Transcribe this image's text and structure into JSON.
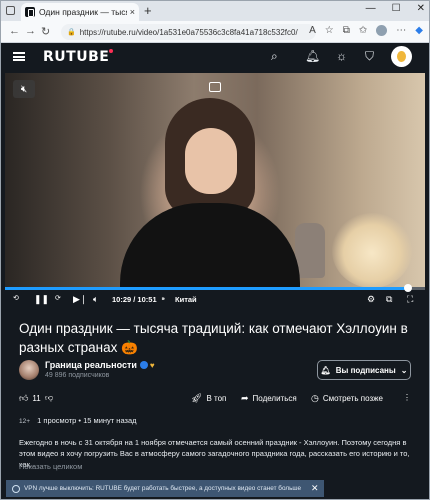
{
  "browser": {
    "tab_title": "Один праздник — тысяча традиц",
    "tab_close": "×",
    "new_tab": "+",
    "url": "https://rutube.ru/video/1a531e0a75536c3c8fa41a718c532fc0/",
    "minimize": "—",
    "maximize": "☐",
    "close": "✕"
  },
  "site": {
    "logo": "RUTUBE",
    "accent": "#ff2f55"
  },
  "player": {
    "progress": 0.96,
    "time": "10:29 / 10:51",
    "chapter": "Китай",
    "progress_color": "#1e9cff"
  },
  "video": {
    "title": "Один праздник — тысяча традиций: как отмечают Хэллоуин в разных странах 🎃",
    "channel": {
      "name": "Граница реальности",
      "subscribers": "49 896 подписчиков",
      "subscribe_label": "Вы подписаны"
    },
    "likes": "11",
    "actions": {
      "top": "В топ",
      "share": "Поделиться",
      "watch_later": "Смотреть позже"
    },
    "age": "12+",
    "views": "1 просмотр",
    "posted": "15 минут назад",
    "description": "Ежегодно в ночь с 31 октября на 1 ноября отмечается самый осенний праздник - Хэллоуин. Поэтому сегодня в этом видео я хочу погрузить Вас в атмосферу самого загадочного праздника года, рассказать его историю и то, как...",
    "show_more": "Показать целиком"
  },
  "toast": {
    "text": "VPN лучше выключить: RUTUBE будет работать быстрее, а доступных видео станет больше"
  }
}
